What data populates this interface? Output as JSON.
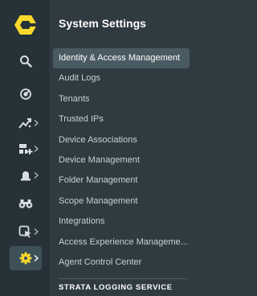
{
  "colors": {
    "rail_bg": "#263238",
    "panel_bg": "#2f3b41",
    "active_item_bg": "#4a5a62",
    "active_rail_bg": "#3d5058",
    "brand_yellow": "#fad82d",
    "icon": "#d8dee1"
  },
  "rail": {
    "items": [
      {
        "icon": "search-icon"
      },
      {
        "icon": "radar-icon"
      },
      {
        "icon": "activity-chart-icon",
        "has_chevron": true
      },
      {
        "icon": "dashboard-add-icon",
        "has_chevron": true
      },
      {
        "icon": "alarm-bell-icon",
        "has_chevron": true
      },
      {
        "icon": "binoculars-icon"
      },
      {
        "icon": "cursor-window-icon",
        "has_chevron": true
      },
      {
        "icon": "gear-icon",
        "has_chevron": true,
        "active": true
      }
    ]
  },
  "panel": {
    "title": "System Settings",
    "items": [
      {
        "label": "Identity & Access Management",
        "active": true
      },
      {
        "label": "Audit Logs"
      },
      {
        "label": "Tenants"
      },
      {
        "label": "Trusted IPs"
      },
      {
        "label": "Device Associations"
      },
      {
        "label": "Device Management"
      },
      {
        "label": "Folder Management"
      },
      {
        "label": "Scope Management"
      },
      {
        "label": "Integrations"
      },
      {
        "label": "Access Experience Manageme..."
      },
      {
        "label": "Agent Control Center"
      }
    ],
    "section_title": "STRATA LOGGING SERVICE"
  }
}
